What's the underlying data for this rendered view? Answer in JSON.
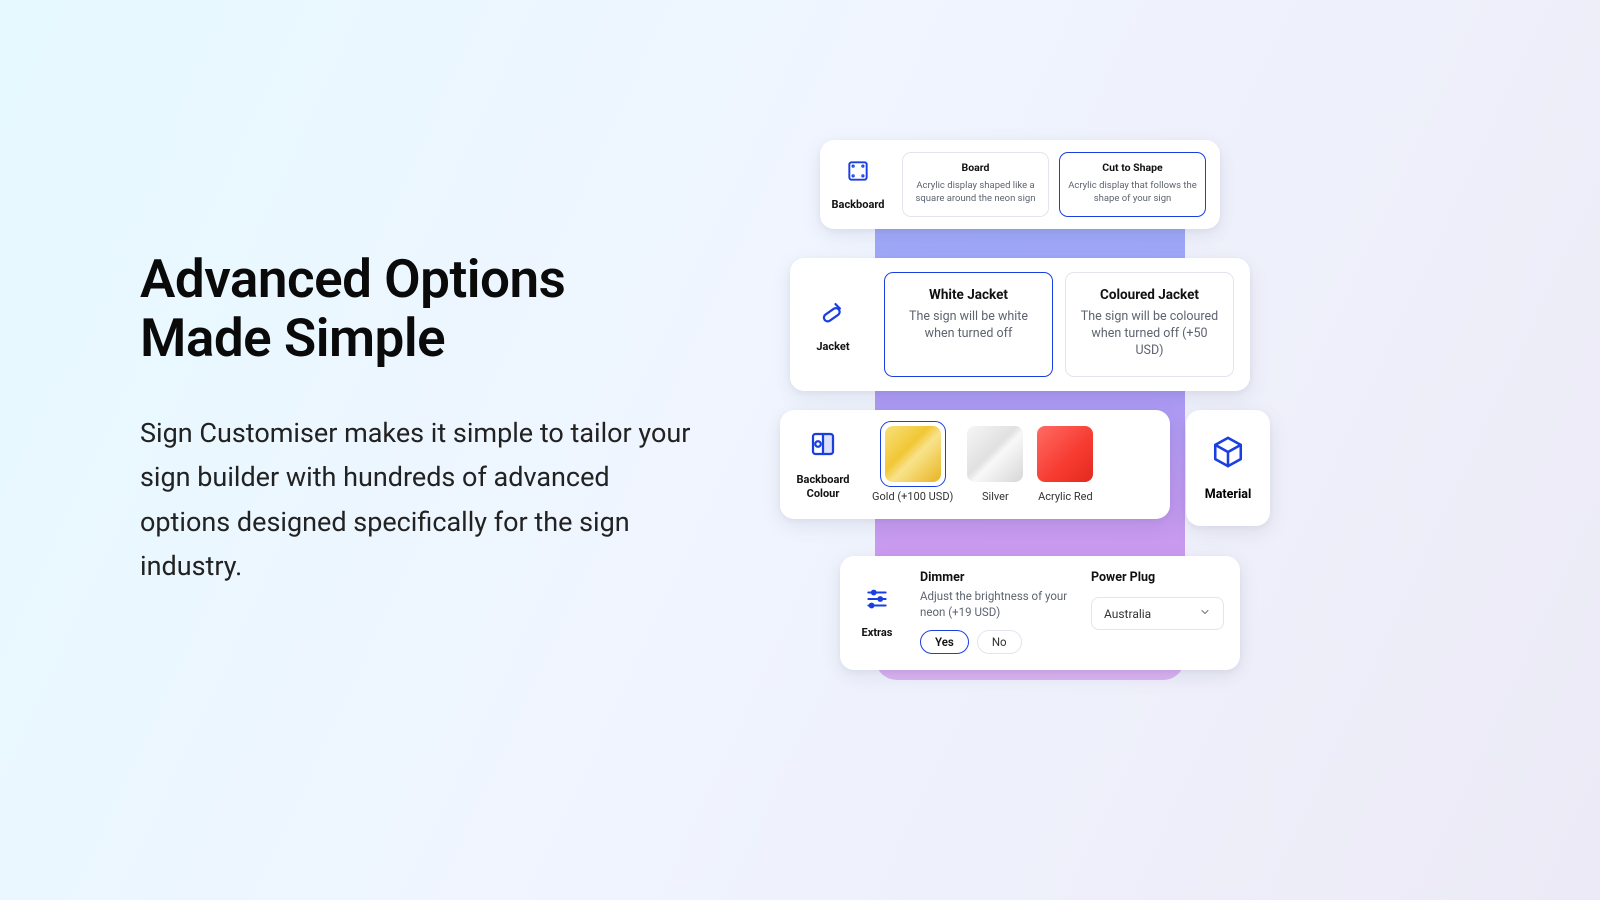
{
  "hero": {
    "title_line1": "Advanced Options",
    "title_line2": "Made Simple",
    "body": "Sign Customiser makes it simple to tailor your sign builder with hundreds of advanced options designed specifically for the sign industry."
  },
  "backboard": {
    "label": "Backboard",
    "options": [
      {
        "title": "Board",
        "desc": "Acrylic display shaped like a square around the neon sign",
        "selected": false
      },
      {
        "title": "Cut to Shape",
        "desc": "Acrylic display that follows the shape of your sign",
        "selected": true
      }
    ]
  },
  "jacket": {
    "label": "Jacket",
    "options": [
      {
        "title": "White Jacket",
        "desc": "The sign will be white when turned off",
        "selected": true
      },
      {
        "title": "Coloured Jacket",
        "desc": "The sign will be coloured when turned off (+50 USD)",
        "selected": false
      }
    ]
  },
  "backboard_colour": {
    "label": "Backboard Colour",
    "swatches": [
      {
        "name": "Gold (+100 USD)",
        "selected": true
      },
      {
        "name": "Silver",
        "selected": false
      },
      {
        "name": "Acrylic Red",
        "selected": false
      }
    ]
  },
  "material": {
    "label": "Material"
  },
  "extras": {
    "label": "Extras",
    "dimmer": {
      "title": "Dimmer",
      "desc": "Adjust the brightness of your neon (+19 USD)",
      "yes": "Yes",
      "no": "No",
      "selected": "Yes"
    },
    "power_plug": {
      "title": "Power Plug",
      "value": "Australia"
    }
  }
}
